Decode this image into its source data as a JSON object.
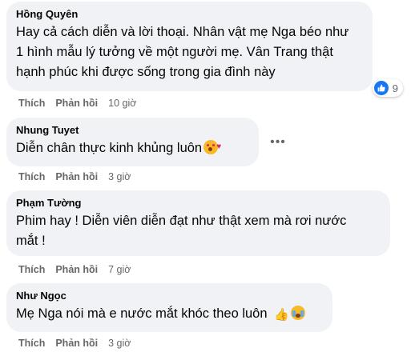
{
  "comments": [
    {
      "author": "Hồng Quyên",
      "lines": [
        "Hay cả cách diễn và lời thoại. Nhân vật mẹ Nga béo như",
        "1 hình mẫu lý tưởng về một người mẹ. Vân Trang thật",
        "hạnh phúc khi được sống trong gia đình này"
      ],
      "like_label": "Thích",
      "reply_label": "Phản hồi",
      "time": "10 giờ",
      "reaction_count": "9",
      "reaction_icon": "like-icon"
    },
    {
      "author": "Nhung Tuyet",
      "lines": [
        "Diễn chân thực kinh khủng luôn"
      ],
      "emoji": "smiling-face-with-hearts-icon",
      "like_label": "Thích",
      "reply_label": "Phản hồi",
      "time": "3 giờ"
    },
    {
      "author": "Phạm Tường",
      "lines": [
        "Phim hay ! Diễn viên diễn đạt như thật xem mà rơi nước",
        "mắt !"
      ],
      "like_label": "Thích",
      "reply_label": "Phản hồi",
      "time": "7 giờ"
    },
    {
      "author": "Như Ngọc",
      "lines": [
        "Mẹ Nga nói mà e nước mắt khóc theo luôn"
      ],
      "emoji": [
        "thumbs-up-icon",
        "crying-face-icon"
      ],
      "like_label": "Thích",
      "reply_label": "Phản hồi",
      "time": "3 giờ"
    }
  ],
  "more_options_label": "•••",
  "colors": {
    "bubble": "#f0f2f5",
    "text": "#050505",
    "meta": "#65676b",
    "like_blue": "#1877f2"
  }
}
